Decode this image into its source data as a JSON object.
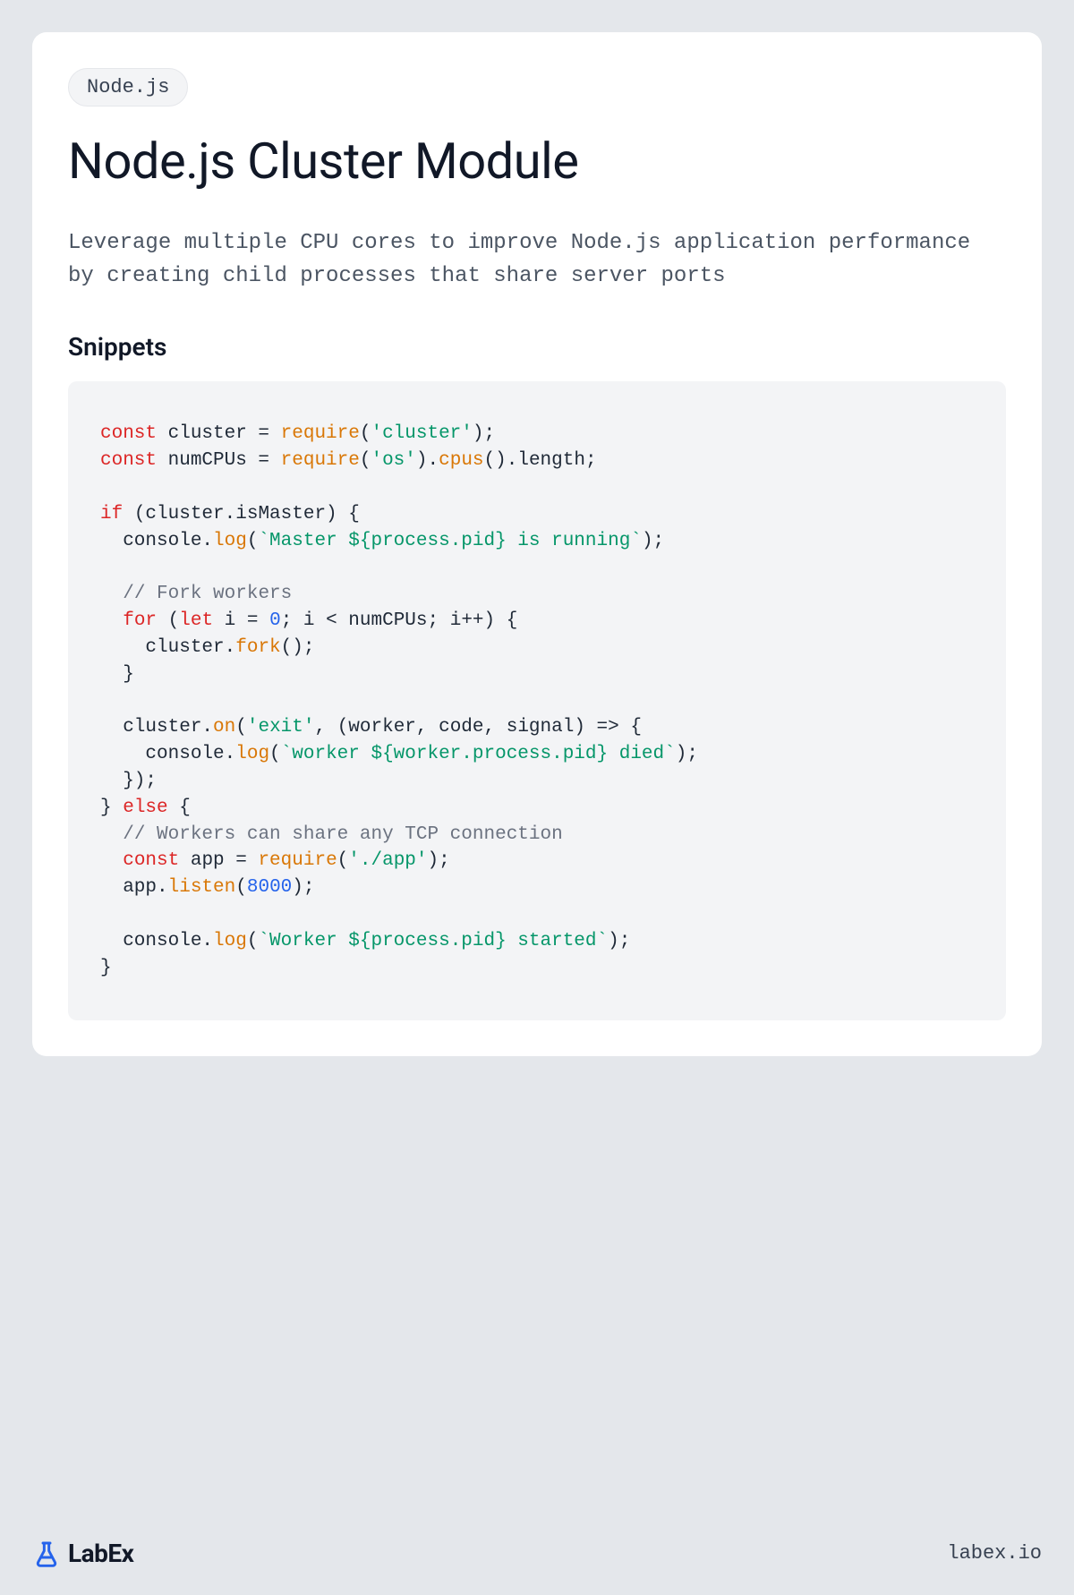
{
  "tag": "Node.js",
  "title": "Node.js Cluster Module",
  "description": "Leverage multiple CPU cores to improve Node.js application performance by creating child processes that share server ports",
  "section_heading": "Snippets",
  "code_tokens": [
    {
      "c": "tok-kw",
      "t": "const"
    },
    {
      "t": " cluster = "
    },
    {
      "c": "tok-fn",
      "t": "require"
    },
    {
      "t": "("
    },
    {
      "c": "tok-str",
      "t": "'cluster'"
    },
    {
      "t": ");\n"
    },
    {
      "c": "tok-kw",
      "t": "const"
    },
    {
      "t": " numCPUs = "
    },
    {
      "c": "tok-fn",
      "t": "require"
    },
    {
      "t": "("
    },
    {
      "c": "tok-str",
      "t": "'os'"
    },
    {
      "t": ")."
    },
    {
      "c": "tok-fn",
      "t": "cpus"
    },
    {
      "t": "().length;\n"
    },
    {
      "t": "\n"
    },
    {
      "c": "tok-kw",
      "t": "if"
    },
    {
      "t": " (cluster.isMaster) {\n"
    },
    {
      "t": "  console."
    },
    {
      "c": "tok-fn",
      "t": "log"
    },
    {
      "t": "("
    },
    {
      "c": "tok-str",
      "t": "`Master ${process.pid} is running`"
    },
    {
      "t": ");\n"
    },
    {
      "t": "\n"
    },
    {
      "t": "  "
    },
    {
      "c": "tok-com",
      "t": "// Fork workers"
    },
    {
      "t": "\n"
    },
    {
      "t": "  "
    },
    {
      "c": "tok-kw",
      "t": "for"
    },
    {
      "t": " ("
    },
    {
      "c": "tok-kw",
      "t": "let"
    },
    {
      "t": " i = "
    },
    {
      "c": "tok-num",
      "t": "0"
    },
    {
      "t": "; i < numCPUs; i++) {\n"
    },
    {
      "t": "    cluster."
    },
    {
      "c": "tok-fn",
      "t": "fork"
    },
    {
      "t": "();\n"
    },
    {
      "t": "  }\n"
    },
    {
      "t": "\n"
    },
    {
      "t": "  cluster."
    },
    {
      "c": "tok-fn",
      "t": "on"
    },
    {
      "t": "("
    },
    {
      "c": "tok-str",
      "t": "'exit'"
    },
    {
      "t": ", (worker, code, signal) => {\n"
    },
    {
      "t": "    console."
    },
    {
      "c": "tok-fn",
      "t": "log"
    },
    {
      "t": "("
    },
    {
      "c": "tok-str",
      "t": "`worker ${worker.process.pid} died`"
    },
    {
      "t": ");\n"
    },
    {
      "t": "  });\n"
    },
    {
      "t": "} "
    },
    {
      "c": "tok-kw",
      "t": "else"
    },
    {
      "t": " {\n"
    },
    {
      "t": "  "
    },
    {
      "c": "tok-com",
      "t": "// Workers can share any TCP connection"
    },
    {
      "t": "\n"
    },
    {
      "t": "  "
    },
    {
      "c": "tok-kw",
      "t": "const"
    },
    {
      "t": " app = "
    },
    {
      "c": "tok-fn",
      "t": "require"
    },
    {
      "t": "("
    },
    {
      "c": "tok-str",
      "t": "'./app'"
    },
    {
      "t": ");\n"
    },
    {
      "t": "  app."
    },
    {
      "c": "tok-fn",
      "t": "listen"
    },
    {
      "t": "("
    },
    {
      "c": "tok-num",
      "t": "8000"
    },
    {
      "t": ");\n"
    },
    {
      "t": "\n"
    },
    {
      "t": "  console."
    },
    {
      "c": "tok-fn",
      "t": "log"
    },
    {
      "t": "("
    },
    {
      "c": "tok-str",
      "t": "`Worker ${process.pid} started`"
    },
    {
      "t": ");\n"
    },
    {
      "t": "}"
    }
  ],
  "brand": {
    "name": "LabEx",
    "url": "labex.io"
  }
}
